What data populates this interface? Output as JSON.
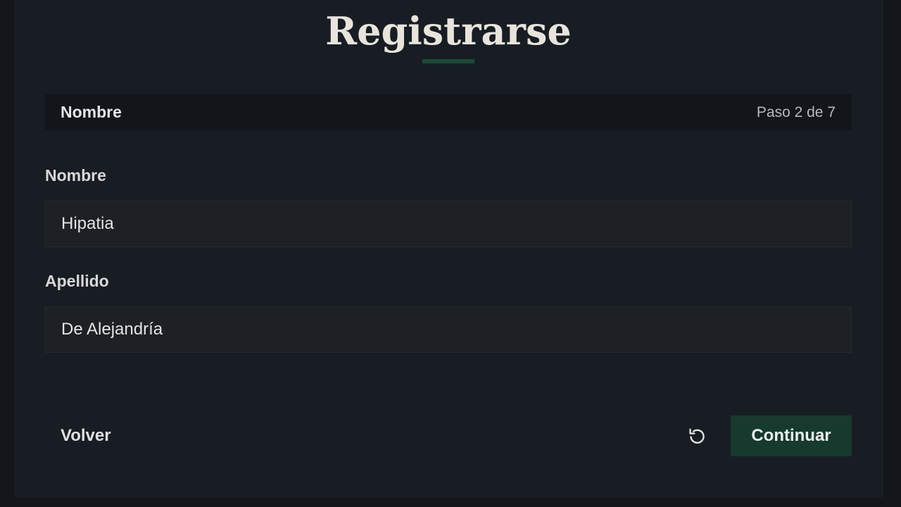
{
  "page": {
    "title": "Registrarse"
  },
  "step": {
    "name": "Nombre",
    "progress_text": "Paso 2 de 7"
  },
  "fields": [
    {
      "label": "Nombre",
      "value": "Hipatia"
    },
    {
      "label": "Apellido",
      "value": "De Alejandría"
    }
  ],
  "actions": {
    "back_label": "Volver",
    "reset_icon": "reset-icon",
    "continue_label": "Continuar"
  },
  "colors": {
    "background": "#13171c",
    "card": "#181d23",
    "accent": "#1b4a36",
    "primary_button": "#163a2d"
  }
}
